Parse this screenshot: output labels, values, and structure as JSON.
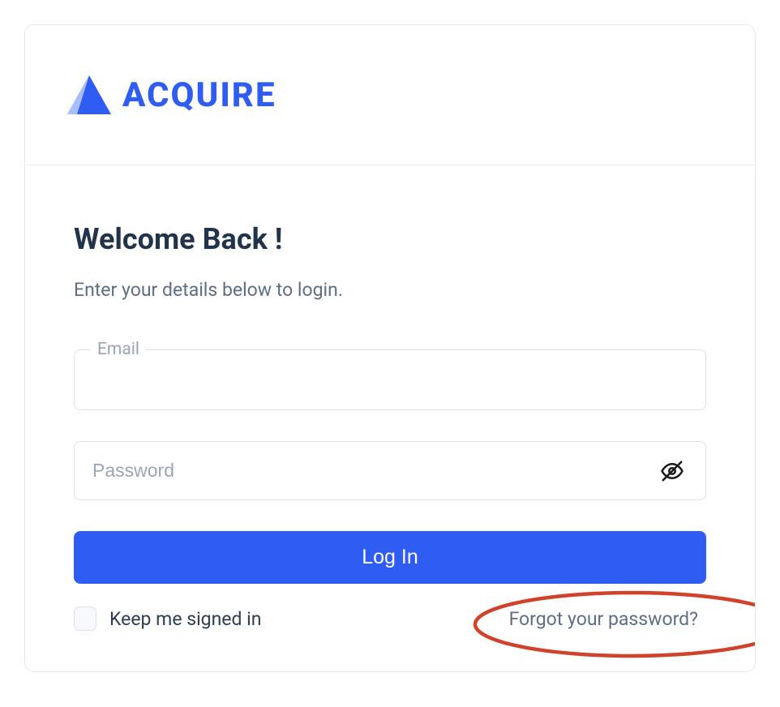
{
  "brand": {
    "name": "ACQUIRE"
  },
  "heading": "Welcome Back !",
  "subheading": "Enter your details below to login.",
  "fields": {
    "email": {
      "label": "Email",
      "value": ""
    },
    "password": {
      "placeholder": "Password",
      "value": ""
    }
  },
  "buttons": {
    "login": "Log In"
  },
  "remember": {
    "label": "Keep me signed in",
    "checked": false
  },
  "forgot": {
    "label": "Forgot your password?"
  },
  "colors": {
    "primary": "#2f5cf2",
    "annotation": "#d0432a"
  }
}
